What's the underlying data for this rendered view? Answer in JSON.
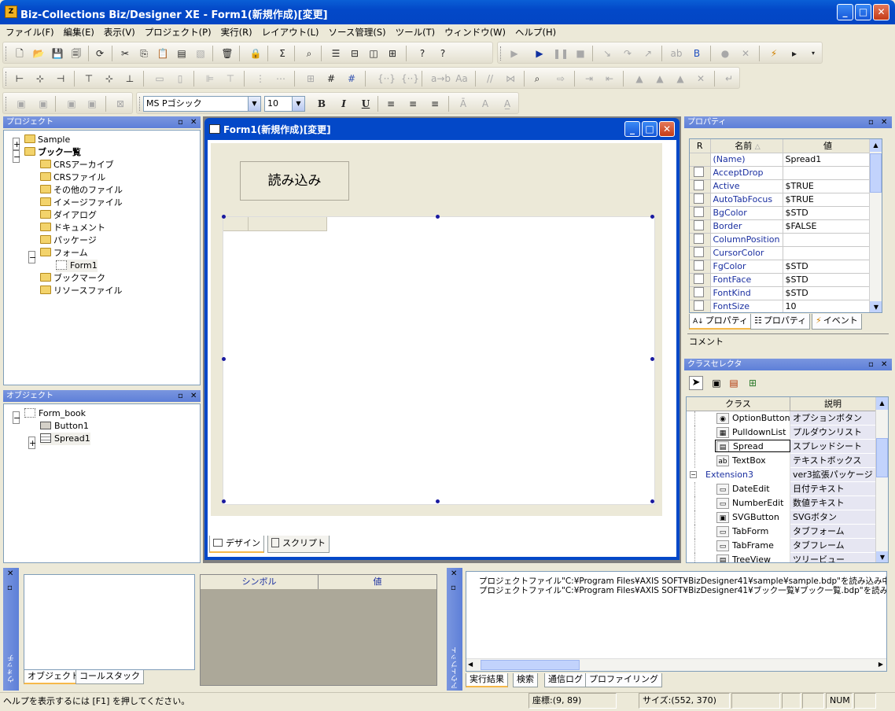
{
  "app": {
    "title": "Biz-Collections Biz/Designer XE - Form1(新規作成)[変更]"
  },
  "menu": [
    "ファイル(F)",
    "編集(E)",
    "表示(V)",
    "プロジェクト(P)",
    "実行(R)",
    "レイアウト(L)",
    "ソース管理(S)",
    "ツール(T)",
    "ウィンドウ(W)",
    "ヘルプ(H)"
  ],
  "toolbar": {
    "font_name": "MS Pゴシック",
    "font_size": "10",
    "bold": "B",
    "italic": "I",
    "underline": "U"
  },
  "project": {
    "header": "プロジェクト",
    "items": [
      "Sample",
      "ブック一覧",
      "CRSアーカイブ",
      "CRSファイル",
      "その他のファイル",
      "イメージファイル",
      "ダイアログ",
      "ドキュメント",
      "パッケージ",
      "フォーム",
      "Form1",
      "ブックマーク",
      "リソースファイル"
    ]
  },
  "object": {
    "header": "オブジェクト",
    "items": [
      "Form_book",
      "Button1",
      "Spread1"
    ]
  },
  "form": {
    "title": "Form1(新規作成)[変更]",
    "button_label": "読み込み",
    "tab_design": "デザイン",
    "tab_script": "スクリプト"
  },
  "props": {
    "header": "プロパティ",
    "col_r": "R",
    "col_name": "名前",
    "col_value": "値",
    "rows": [
      {
        "name": "(Name)",
        "value": "Spread1"
      },
      {
        "name": "AcceptDrop",
        "value": ""
      },
      {
        "name": "Active",
        "value": "$TRUE"
      },
      {
        "name": "AutoTabFocus",
        "value": "$TRUE"
      },
      {
        "name": "BgColor",
        "value": "$STD"
      },
      {
        "name": "Border",
        "value": "$FALSE"
      },
      {
        "name": "ColumnPosition",
        "value": ""
      },
      {
        "name": "CursorColor",
        "value": ""
      },
      {
        "name": "FgColor",
        "value": "$STD"
      },
      {
        "name": "FontFace",
        "value": "$STD"
      },
      {
        "name": "FontKind",
        "value": "$STD"
      },
      {
        "name": "FontSize",
        "value": "10"
      }
    ],
    "tabs": [
      "プロパティ",
      "プロパティ",
      "イベント"
    ],
    "comment": "コメント"
  },
  "classsel": {
    "header": "クラスセレクタ",
    "col_class": "クラス",
    "col_desc": "説明",
    "rows": [
      {
        "cls": "OptionButton",
        "desc": "オプションボタン"
      },
      {
        "cls": "PulldownList",
        "desc": "プルダウンリスト"
      },
      {
        "cls": "Spread",
        "desc": "スプレッドシート"
      },
      {
        "cls": "TextBox",
        "desc": "テキストボックス"
      },
      {
        "cls": "Extension3",
        "desc": "ver3拡張パッケージ"
      },
      {
        "cls": "DateEdit",
        "desc": "日付テキスト"
      },
      {
        "cls": "NumberEdit",
        "desc": "数値テキスト"
      },
      {
        "cls": "SVGButton",
        "desc": "SVGボタン"
      },
      {
        "cls": "TabForm",
        "desc": "タブフォーム"
      },
      {
        "cls": "TabFrame",
        "desc": "タブフレーム"
      },
      {
        "cls": "TreeView",
        "desc": "ツリービュー"
      }
    ]
  },
  "watch": {
    "side": "ウォッチ",
    "tab_obj": "オブジェクト",
    "tab_call": "コールスタック",
    "col_symbol": "シンボル",
    "col_value": "値"
  },
  "output": {
    "side": "アウトプット",
    "lines": [
      "プロジェクトファイル\"C:¥Program Files¥AXIS SOFT¥BizDesigner41¥sample¥sample.bdp\"を読み込み中...完",
      "プロジェクトファイル\"C:¥Program Files¥AXIS SOFT¥BizDesigner41¥ブック一覧¥ブック一覧.bdp\"を読み込み中"
    ],
    "tabs": [
      "実行結果",
      "検索",
      "通信ログ",
      "プロファイリング"
    ]
  },
  "status": {
    "help": "ヘルプを表示するには [F1] を押してください。",
    "coords": "座標:(9, 89)",
    "size": "サイズ:(552, 370)",
    "num": "NUM"
  }
}
